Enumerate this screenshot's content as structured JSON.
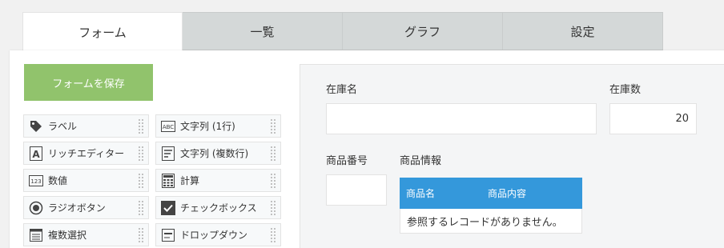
{
  "tabs": [
    {
      "label": "フォーム",
      "active": true
    },
    {
      "label": "一覧",
      "active": false
    },
    {
      "label": "グラフ",
      "active": false
    },
    {
      "label": "設定",
      "active": false
    }
  ],
  "save_button": {
    "label": "フォームを保存"
  },
  "palette": {
    "items": [
      {
        "label": "ラベル",
        "icon": "tag-icon"
      },
      {
        "label": "文字列 (1行)",
        "icon": "abc-text-icon"
      },
      {
        "label": "リッチエディター",
        "icon": "rich-editor-icon"
      },
      {
        "label": "文字列 (複数行)",
        "icon": "multiline-text-icon"
      },
      {
        "label": "数値",
        "icon": "number-123-icon"
      },
      {
        "label": "計算",
        "icon": "calculator-icon"
      },
      {
        "label": "ラジオボタン",
        "icon": "radio-button-icon"
      },
      {
        "label": "チェックボックス",
        "icon": "checkbox-icon"
      },
      {
        "label": "複数選択",
        "icon": "multi-select-icon"
      },
      {
        "label": "ドロップダウン",
        "icon": "dropdown-icon"
      }
    ]
  },
  "form": {
    "stock_name": {
      "label": "在庫名",
      "value": ""
    },
    "stock_count": {
      "label": "在庫数",
      "value": "20"
    },
    "product_number": {
      "label": "商品番号",
      "value": ""
    },
    "product_info": {
      "label": "商品情報",
      "columns": [
        "商品名",
        "商品内容"
      ],
      "empty_message": "参照するレコードがありません。"
    }
  },
  "colors": {
    "save_button": "#91c36c",
    "table_header": "#3498db",
    "tab_inactive": "#d4d8d8"
  }
}
